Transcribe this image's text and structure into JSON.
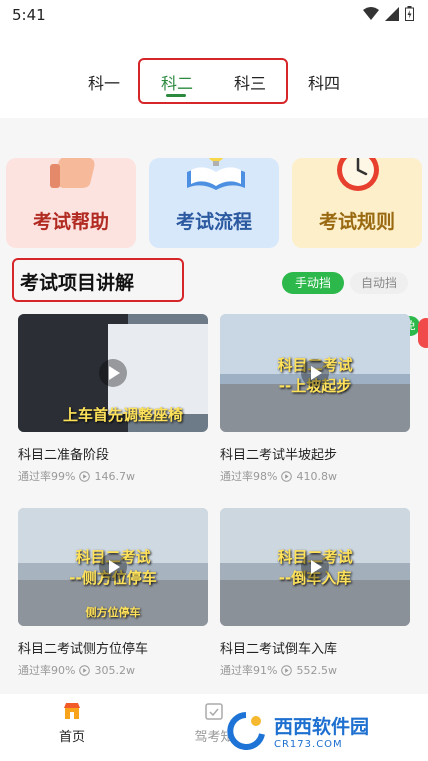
{
  "status": {
    "time": "5:41"
  },
  "tabs": [
    "科一",
    "科二",
    "科三",
    "科四"
  ],
  "cards": [
    {
      "label": "考试帮助",
      "icon": "thumbs-up-icon"
    },
    {
      "label": "考试流程",
      "icon": "book-lightbulb-icon"
    },
    {
      "label": "考试规则",
      "icon": "alarm-clock-icon"
    }
  ],
  "section": {
    "title": "考试项目讲解",
    "toggle_active": "手动挡",
    "toggle_inactive": "自动挡"
  },
  "videos": [
    {
      "title": "科目二准备阶段",
      "pass": "通过率99%",
      "views": "146.7w",
      "caption": "上车首先调整座椅"
    },
    {
      "title": "科目二考试半坡起步",
      "pass": "通过率98%",
      "views": "410.8w",
      "caption": "科目二考试\n--上坡起步"
    },
    {
      "title": "科目二考试侧方位停车",
      "pass": "通过率90%",
      "views": "305.2w",
      "caption": "科目二考试\n--侧方位停车",
      "sub": "侧方位停车"
    },
    {
      "title": "科目二考试倒车入库",
      "pass": "通过率91%",
      "views": "552.5w",
      "caption": "科目二考试\n--倒车入库"
    }
  ],
  "nav": [
    {
      "label": "首页"
    },
    {
      "label": "驾考知"
    }
  ],
  "watermark": {
    "text1": "西西软件园",
    "text2": "CR173.COM"
  },
  "colors": {
    "accent": "#2b8a3e",
    "highlight": "#d7262a"
  }
}
